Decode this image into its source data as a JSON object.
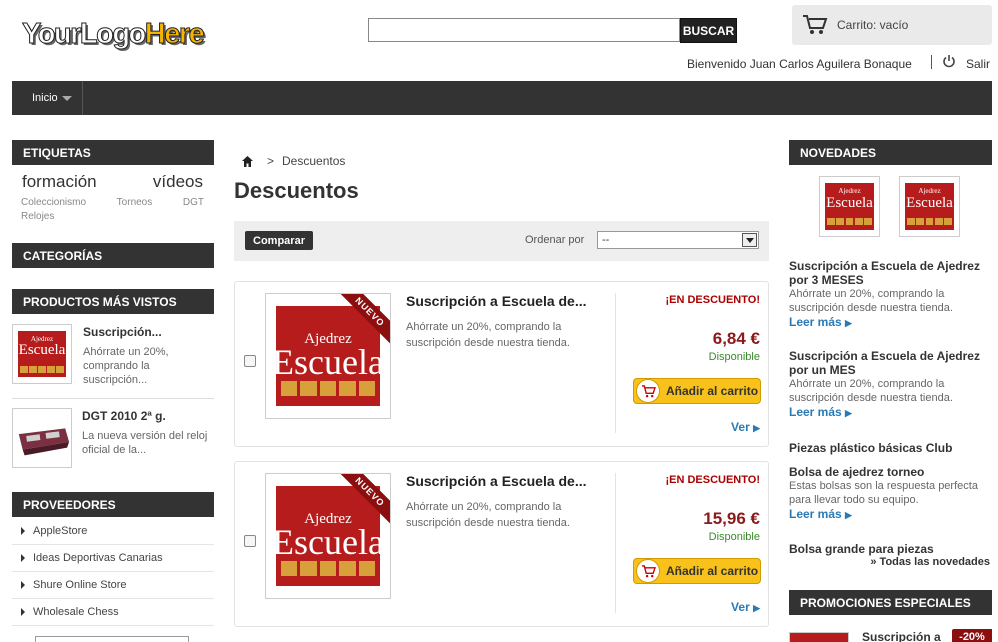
{
  "header": {
    "logo_text_white": "YourLogo",
    "logo_text_orange": "Here",
    "search": {
      "value": "",
      "button_label": "BUSCAR"
    },
    "cart_label": "Carrito: vacío",
    "welcome": "Bienvenido Juan Carlos Aguilera Bonaque",
    "logout_label": "Salir"
  },
  "nav": {
    "home_label": "Inicio"
  },
  "left": {
    "tags_title": "ETIQUETAS",
    "tags_big": [
      "formación",
      "vídeos"
    ],
    "tags_small_row1": [
      "Coleccionismo",
      "Torneos",
      "DGT"
    ],
    "tags_small_row2": [
      "Relojes"
    ],
    "categories_title": "CATEGORÍAS",
    "most_viewed_title": "PRODUCTOS MÁS VISTOS",
    "most_viewed": [
      {
        "title": "Suscripción...",
        "desc": "Ahórrate un 20%, comprando la suscripción..."
      },
      {
        "title": "DGT 2010 2ª g.",
        "desc": "La nueva versión del reloj oficial de la..."
      }
    ],
    "suppliers_title": "PROVEEDORES",
    "suppliers": [
      "AppleStore",
      "Ideas Deportivas Canarias",
      "Shure Online Store",
      "Wholesale Chess"
    ]
  },
  "main": {
    "breadcrumb_current": "Descuentos",
    "breadcrumb_sep": ">",
    "title": "Descuentos",
    "compare_label": "Comparar",
    "order_label": "Ordenar por",
    "order_value": "--",
    "products": [
      {
        "title": "Suscripción a Escuela de...",
        "desc": "Ahórrate un 20%, comprando la suscripción desde nuestra tienda.",
        "discount_label": "¡EN DESCUENTO!",
        "price": "6,84 €",
        "availability": "Disponible",
        "add_label": "Añadir al carrito",
        "view_label": "Ver",
        "ribbon": "NUEVO"
      },
      {
        "title": "Suscripción a Escuela de...",
        "desc": "Ahórrate un 20%, comprando la suscripción desde nuestra tienda.",
        "discount_label": "¡EN DESCUENTO!",
        "price": "15,96 €",
        "availability": "Disponible",
        "add_label": "Añadir al carrito",
        "view_label": "Ver",
        "ribbon": "NUEVO"
      }
    ]
  },
  "image_text": {
    "ajedrez": "Ajedrez",
    "escuela": "Escuela"
  },
  "right": {
    "news_title": "NOVEDADES",
    "news": [
      {
        "title": "Suscripción a Escuela de Ajedrez por 3 MESES",
        "desc": "Ahórrate un 20%, comprando la suscripción desde nuestra tienda.",
        "more": "Leer más"
      },
      {
        "title": "Suscripción a Escuela de Ajedrez por un MES",
        "desc": "Ahórrate un 20%, comprando la suscripción desde nuestra tienda.",
        "more": "Leer más"
      },
      {
        "title": "Piezas plástico básicas Club"
      },
      {
        "title": "Bolsa de ajedrez torneo",
        "desc": "Estas bolsas son la respuesta perfecta para llevar todo su equipo.",
        "more": "Leer más"
      },
      {
        "title": "Bolsa grande para piezas"
      }
    ],
    "all_news": "» Todas las novedades",
    "promos_title": "PROMOCIONES ESPECIALES",
    "promo_item_title": "Suscripción a",
    "promo_badge": "-20%"
  },
  "colors": {
    "dark_bar": "#333333",
    "accent_red": "#b71c1c",
    "link_blue": "#2a7ab5",
    "button_yellow": "#f8c21a",
    "available_green": "#3a8a2c"
  }
}
